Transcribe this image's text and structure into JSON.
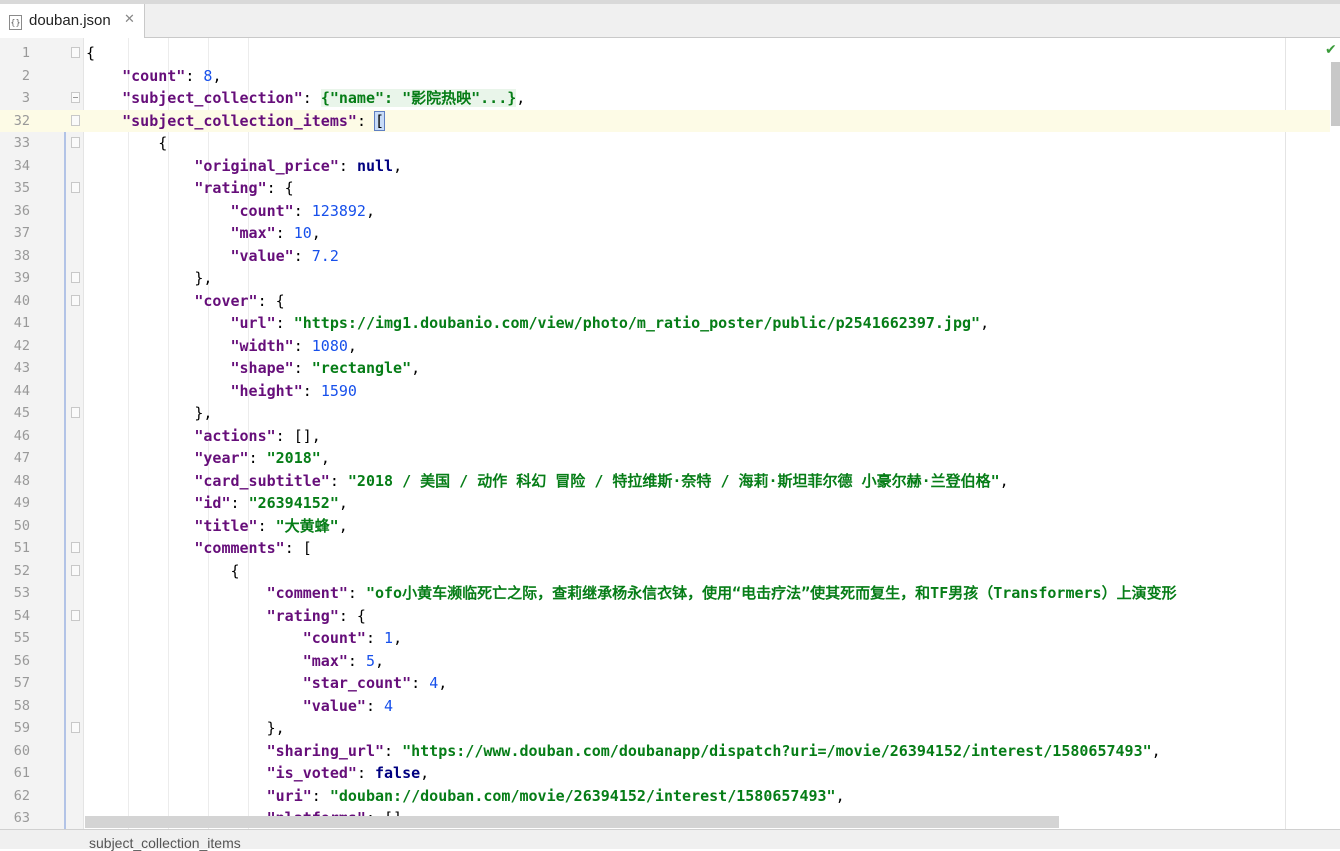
{
  "tab": {
    "filename": "douban.json",
    "close_symbol": "✕",
    "icon_glyph": "{}"
  },
  "status": {
    "breadcrumb": "subject_collection_items"
  },
  "icons": {
    "file": "json-file-icon",
    "close": "close-icon",
    "inspection": "check-icon",
    "check_glyph": "✔"
  },
  "lines": [
    {
      "num": "1",
      "tokens": [
        {
          "t": "p",
          "v": "{"
        }
      ]
    },
    {
      "num": "2",
      "tokens": [
        {
          "t": "p",
          "v": "    "
        },
        {
          "t": "k",
          "v": "\"count\""
        },
        {
          "t": "p",
          "v": ": "
        },
        {
          "t": "n",
          "v": "8"
        },
        {
          "t": "p",
          "v": ","
        }
      ]
    },
    {
      "num": "3",
      "tokens": [
        {
          "t": "p",
          "v": "    "
        },
        {
          "t": "k",
          "v": "\"subject_collection\""
        },
        {
          "t": "p",
          "v": ": "
        },
        {
          "t": "folded",
          "v": "{\"name\": \"影院热映\"...}"
        },
        {
          "t": "p",
          "v": ","
        }
      ]
    },
    {
      "num": "32",
      "tokens": [
        {
          "t": "p",
          "v": "    "
        },
        {
          "t": "k",
          "v": "\"subject_collection_items\""
        },
        {
          "t": "p",
          "v": ": "
        },
        {
          "t": "bracket",
          "v": "["
        }
      ]
    },
    {
      "num": "33",
      "tokens": [
        {
          "t": "p",
          "v": "        {"
        }
      ]
    },
    {
      "num": "34",
      "tokens": [
        {
          "t": "p",
          "v": "            "
        },
        {
          "t": "k",
          "v": "\"original_price\""
        },
        {
          "t": "p",
          "v": ": "
        },
        {
          "t": "kw",
          "v": "null"
        },
        {
          "t": "p",
          "v": ","
        }
      ]
    },
    {
      "num": "35",
      "tokens": [
        {
          "t": "p",
          "v": "            "
        },
        {
          "t": "k",
          "v": "\"rating\""
        },
        {
          "t": "p",
          "v": ": {"
        }
      ]
    },
    {
      "num": "36",
      "tokens": [
        {
          "t": "p",
          "v": "                "
        },
        {
          "t": "k",
          "v": "\"count\""
        },
        {
          "t": "p",
          "v": ": "
        },
        {
          "t": "n",
          "v": "123892"
        },
        {
          "t": "p",
          "v": ","
        }
      ]
    },
    {
      "num": "37",
      "tokens": [
        {
          "t": "p",
          "v": "                "
        },
        {
          "t": "k",
          "v": "\"max\""
        },
        {
          "t": "p",
          "v": ": "
        },
        {
          "t": "n",
          "v": "10"
        },
        {
          "t": "p",
          "v": ","
        }
      ]
    },
    {
      "num": "38",
      "tokens": [
        {
          "t": "p",
          "v": "                "
        },
        {
          "t": "k",
          "v": "\"value\""
        },
        {
          "t": "p",
          "v": ": "
        },
        {
          "t": "n",
          "v": "7.2"
        }
      ]
    },
    {
      "num": "39",
      "tokens": [
        {
          "t": "p",
          "v": "            },"
        }
      ]
    },
    {
      "num": "40",
      "tokens": [
        {
          "t": "p",
          "v": "            "
        },
        {
          "t": "k",
          "v": "\"cover\""
        },
        {
          "t": "p",
          "v": ": {"
        }
      ]
    },
    {
      "num": "41",
      "tokens": [
        {
          "t": "p",
          "v": "                "
        },
        {
          "t": "k",
          "v": "\"url\""
        },
        {
          "t": "p",
          "v": ": "
        },
        {
          "t": "s",
          "v": "\"https://img1.doubanio.com/view/photo/m_ratio_poster/public/p2541662397.jpg\""
        },
        {
          "t": "p",
          "v": ","
        }
      ]
    },
    {
      "num": "42",
      "tokens": [
        {
          "t": "p",
          "v": "                "
        },
        {
          "t": "k",
          "v": "\"width\""
        },
        {
          "t": "p",
          "v": ": "
        },
        {
          "t": "n",
          "v": "1080"
        },
        {
          "t": "p",
          "v": ","
        }
      ]
    },
    {
      "num": "43",
      "tokens": [
        {
          "t": "p",
          "v": "                "
        },
        {
          "t": "k",
          "v": "\"shape\""
        },
        {
          "t": "p",
          "v": ": "
        },
        {
          "t": "s",
          "v": "\"rectangle\""
        },
        {
          "t": "p",
          "v": ","
        }
      ]
    },
    {
      "num": "44",
      "tokens": [
        {
          "t": "p",
          "v": "                "
        },
        {
          "t": "k",
          "v": "\"height\""
        },
        {
          "t": "p",
          "v": ": "
        },
        {
          "t": "n",
          "v": "1590"
        }
      ]
    },
    {
      "num": "45",
      "tokens": [
        {
          "t": "p",
          "v": "            },"
        }
      ]
    },
    {
      "num": "46",
      "tokens": [
        {
          "t": "p",
          "v": "            "
        },
        {
          "t": "k",
          "v": "\"actions\""
        },
        {
          "t": "p",
          "v": ": [],"
        }
      ]
    },
    {
      "num": "47",
      "tokens": [
        {
          "t": "p",
          "v": "            "
        },
        {
          "t": "k",
          "v": "\"year\""
        },
        {
          "t": "p",
          "v": ": "
        },
        {
          "t": "s",
          "v": "\"2018\""
        },
        {
          "t": "p",
          "v": ","
        }
      ]
    },
    {
      "num": "48",
      "tokens": [
        {
          "t": "p",
          "v": "            "
        },
        {
          "t": "k",
          "v": "\"card_subtitle\""
        },
        {
          "t": "p",
          "v": ": "
        },
        {
          "t": "s",
          "v": "\"2018 / 美国 / 动作 科幻 冒险 / 特拉维斯·奈特 / 海莉·斯坦菲尔德 小豪尔赫·兰登伯格\""
        },
        {
          "t": "p",
          "v": ","
        }
      ]
    },
    {
      "num": "49",
      "tokens": [
        {
          "t": "p",
          "v": "            "
        },
        {
          "t": "k",
          "v": "\"id\""
        },
        {
          "t": "p",
          "v": ": "
        },
        {
          "t": "s",
          "v": "\"26394152\""
        },
        {
          "t": "p",
          "v": ","
        }
      ]
    },
    {
      "num": "50",
      "tokens": [
        {
          "t": "p",
          "v": "            "
        },
        {
          "t": "k",
          "v": "\"title\""
        },
        {
          "t": "p",
          "v": ": "
        },
        {
          "t": "s",
          "v": "\"大黄蜂\""
        },
        {
          "t": "p",
          "v": ","
        }
      ]
    },
    {
      "num": "51",
      "tokens": [
        {
          "t": "p",
          "v": "            "
        },
        {
          "t": "k",
          "v": "\"comments\""
        },
        {
          "t": "p",
          "v": ": ["
        }
      ]
    },
    {
      "num": "52",
      "tokens": [
        {
          "t": "p",
          "v": "                {"
        }
      ]
    },
    {
      "num": "53",
      "tokens": [
        {
          "t": "p",
          "v": "                    "
        },
        {
          "t": "k",
          "v": "\"comment\""
        },
        {
          "t": "p",
          "v": ": "
        },
        {
          "t": "s",
          "v": "\"ofo小黄车濒临死亡之际，查莉继承杨永信衣钵，使用“电击疗法”使其死而复生，和TF男孩（Transformers）上演变形"
        }
      ]
    },
    {
      "num": "54",
      "tokens": [
        {
          "t": "p",
          "v": "                    "
        },
        {
          "t": "k",
          "v": "\"rating\""
        },
        {
          "t": "p",
          "v": ": {"
        }
      ]
    },
    {
      "num": "55",
      "tokens": [
        {
          "t": "p",
          "v": "                        "
        },
        {
          "t": "k",
          "v": "\"count\""
        },
        {
          "t": "p",
          "v": ": "
        },
        {
          "t": "n",
          "v": "1"
        },
        {
          "t": "p",
          "v": ","
        }
      ]
    },
    {
      "num": "56",
      "tokens": [
        {
          "t": "p",
          "v": "                        "
        },
        {
          "t": "k",
          "v": "\"max\""
        },
        {
          "t": "p",
          "v": ": "
        },
        {
          "t": "n",
          "v": "5"
        },
        {
          "t": "p",
          "v": ","
        }
      ]
    },
    {
      "num": "57",
      "tokens": [
        {
          "t": "p",
          "v": "                        "
        },
        {
          "t": "k",
          "v": "\"star_count\""
        },
        {
          "t": "p",
          "v": ": "
        },
        {
          "t": "n",
          "v": "4"
        },
        {
          "t": "p",
          "v": ","
        }
      ]
    },
    {
      "num": "58",
      "tokens": [
        {
          "t": "p",
          "v": "                        "
        },
        {
          "t": "k",
          "v": "\"value\""
        },
        {
          "t": "p",
          "v": ": "
        },
        {
          "t": "n",
          "v": "4"
        }
      ]
    },
    {
      "num": "59",
      "tokens": [
        {
          "t": "p",
          "v": "                    },"
        }
      ]
    },
    {
      "num": "60",
      "tokens": [
        {
          "t": "p",
          "v": "                    "
        },
        {
          "t": "k",
          "v": "\"sharing_url\""
        },
        {
          "t": "p",
          "v": ": "
        },
        {
          "t": "s",
          "v": "\"https://www.douban.com/doubanapp/dispatch?uri=/movie/26394152/interest/1580657493\""
        },
        {
          "t": "p",
          "v": ","
        }
      ]
    },
    {
      "num": "61",
      "tokens": [
        {
          "t": "p",
          "v": "                    "
        },
        {
          "t": "k",
          "v": "\"is_voted\""
        },
        {
          "t": "p",
          "v": ": "
        },
        {
          "t": "kw",
          "v": "false"
        },
        {
          "t": "p",
          "v": ","
        }
      ]
    },
    {
      "num": "62",
      "tokens": [
        {
          "t": "p",
          "v": "                    "
        },
        {
          "t": "k",
          "v": "\"uri\""
        },
        {
          "t": "p",
          "v": ": "
        },
        {
          "t": "s",
          "v": "\"douban://douban.com/movie/26394152/interest/1580657493\""
        },
        {
          "t": "p",
          "v": ","
        }
      ]
    },
    {
      "num": "63",
      "tokens": [
        {
          "t": "p",
          "v": "                    "
        },
        {
          "t": "k",
          "v": "\"platforms\""
        },
        {
          "t": "p",
          "v": ": [],"
        }
      ]
    }
  ]
}
